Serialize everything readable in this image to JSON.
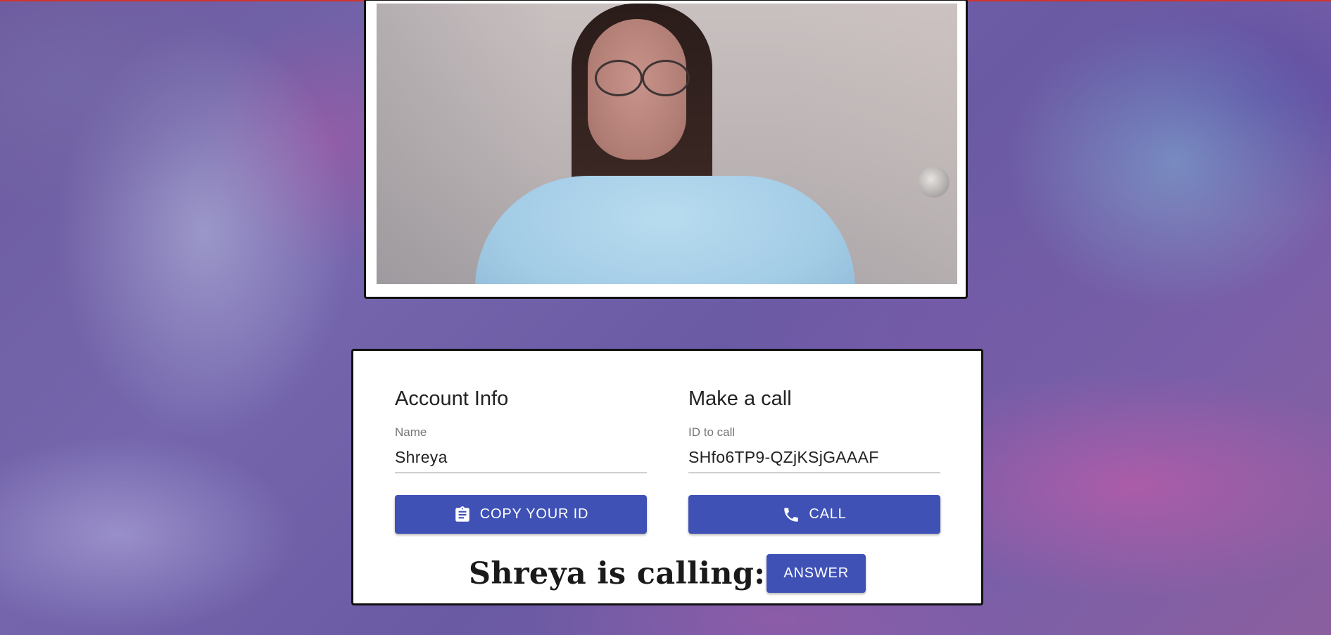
{
  "colors": {
    "primary": "#3f51b5",
    "panel_border": "#111111",
    "top_accent": "#d0342c"
  },
  "video": {
    "description_icon": "local-video-feed"
  },
  "account_info": {
    "title": "Account Info",
    "name_label": "Name",
    "name_value": "Shreya",
    "copy_button_label": "COPY YOUR ID",
    "copy_icon": "clipboard-icon"
  },
  "make_call": {
    "title": "Make a call",
    "id_label": "ID to call",
    "id_value": "SHfo6TP9-QZjKSjGAAAF",
    "call_button_label": "CALL",
    "call_icon": "phone-icon"
  },
  "incoming": {
    "text": "Shreya is calling:",
    "answer_label": "ANSWER"
  }
}
